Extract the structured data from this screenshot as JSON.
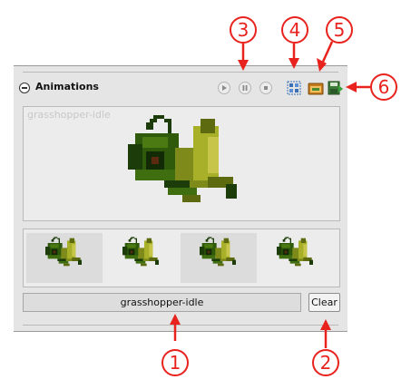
{
  "panel": {
    "title": "Animations",
    "controls": {
      "play_icon": "play-icon",
      "pause_icon": "pause-icon",
      "stop_icon": "stop-icon"
    },
    "tools": [
      "sprite-sheet-icon",
      "open-folder-icon",
      "save-icon"
    ]
  },
  "preview": {
    "animation_name": "grasshopper-idle"
  },
  "frames": {
    "count": 4
  },
  "name_field": {
    "value": "grasshopper-idle"
  },
  "clear_button": {
    "label": "Clear"
  },
  "callouts": [
    "1",
    "2",
    "3",
    "4",
    "5",
    "6"
  ],
  "colors": {
    "callout": "#e8231d",
    "panel_bg": "#e5e5e5",
    "sprite_dark": "#1c3d0a",
    "sprite_mid": "#4c7a12",
    "sprite_light": "#a8b02a"
  }
}
